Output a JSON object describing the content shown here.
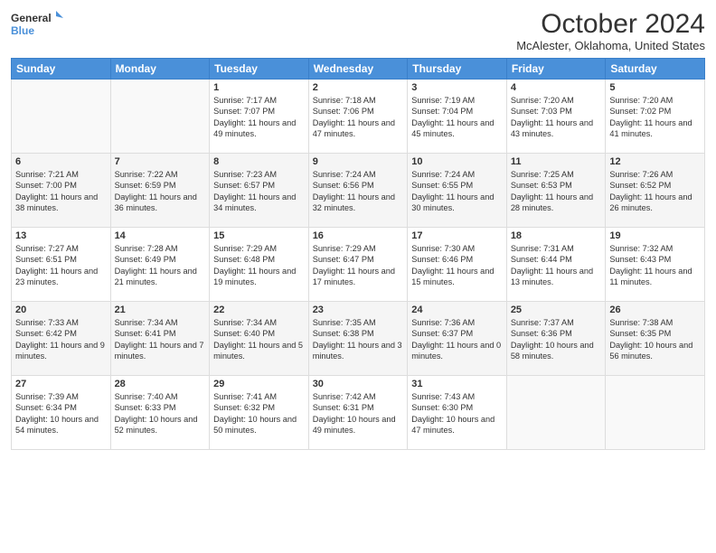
{
  "header": {
    "logo_line1": "General",
    "logo_line2": "Blue",
    "month": "October 2024",
    "location": "McAlester, Oklahoma, United States"
  },
  "days_of_week": [
    "Sunday",
    "Monday",
    "Tuesday",
    "Wednesday",
    "Thursday",
    "Friday",
    "Saturday"
  ],
  "weeks": [
    [
      {
        "day": "",
        "text": ""
      },
      {
        "day": "",
        "text": ""
      },
      {
        "day": "1",
        "text": "Sunrise: 7:17 AM\nSunset: 7:07 PM\nDaylight: 11 hours and 49 minutes."
      },
      {
        "day": "2",
        "text": "Sunrise: 7:18 AM\nSunset: 7:06 PM\nDaylight: 11 hours and 47 minutes."
      },
      {
        "day": "3",
        "text": "Sunrise: 7:19 AM\nSunset: 7:04 PM\nDaylight: 11 hours and 45 minutes."
      },
      {
        "day": "4",
        "text": "Sunrise: 7:20 AM\nSunset: 7:03 PM\nDaylight: 11 hours and 43 minutes."
      },
      {
        "day": "5",
        "text": "Sunrise: 7:20 AM\nSunset: 7:02 PM\nDaylight: 11 hours and 41 minutes."
      }
    ],
    [
      {
        "day": "6",
        "text": "Sunrise: 7:21 AM\nSunset: 7:00 PM\nDaylight: 11 hours and 38 minutes."
      },
      {
        "day": "7",
        "text": "Sunrise: 7:22 AM\nSunset: 6:59 PM\nDaylight: 11 hours and 36 minutes."
      },
      {
        "day": "8",
        "text": "Sunrise: 7:23 AM\nSunset: 6:57 PM\nDaylight: 11 hours and 34 minutes."
      },
      {
        "day": "9",
        "text": "Sunrise: 7:24 AM\nSunset: 6:56 PM\nDaylight: 11 hours and 32 minutes."
      },
      {
        "day": "10",
        "text": "Sunrise: 7:24 AM\nSunset: 6:55 PM\nDaylight: 11 hours and 30 minutes."
      },
      {
        "day": "11",
        "text": "Sunrise: 7:25 AM\nSunset: 6:53 PM\nDaylight: 11 hours and 28 minutes."
      },
      {
        "day": "12",
        "text": "Sunrise: 7:26 AM\nSunset: 6:52 PM\nDaylight: 11 hours and 26 minutes."
      }
    ],
    [
      {
        "day": "13",
        "text": "Sunrise: 7:27 AM\nSunset: 6:51 PM\nDaylight: 11 hours and 23 minutes."
      },
      {
        "day": "14",
        "text": "Sunrise: 7:28 AM\nSunset: 6:49 PM\nDaylight: 11 hours and 21 minutes."
      },
      {
        "day": "15",
        "text": "Sunrise: 7:29 AM\nSunset: 6:48 PM\nDaylight: 11 hours and 19 minutes."
      },
      {
        "day": "16",
        "text": "Sunrise: 7:29 AM\nSunset: 6:47 PM\nDaylight: 11 hours and 17 minutes."
      },
      {
        "day": "17",
        "text": "Sunrise: 7:30 AM\nSunset: 6:46 PM\nDaylight: 11 hours and 15 minutes."
      },
      {
        "day": "18",
        "text": "Sunrise: 7:31 AM\nSunset: 6:44 PM\nDaylight: 11 hours and 13 minutes."
      },
      {
        "day": "19",
        "text": "Sunrise: 7:32 AM\nSunset: 6:43 PM\nDaylight: 11 hours and 11 minutes."
      }
    ],
    [
      {
        "day": "20",
        "text": "Sunrise: 7:33 AM\nSunset: 6:42 PM\nDaylight: 11 hours and 9 minutes."
      },
      {
        "day": "21",
        "text": "Sunrise: 7:34 AM\nSunset: 6:41 PM\nDaylight: 11 hours and 7 minutes."
      },
      {
        "day": "22",
        "text": "Sunrise: 7:34 AM\nSunset: 6:40 PM\nDaylight: 11 hours and 5 minutes."
      },
      {
        "day": "23",
        "text": "Sunrise: 7:35 AM\nSunset: 6:38 PM\nDaylight: 11 hours and 3 minutes."
      },
      {
        "day": "24",
        "text": "Sunrise: 7:36 AM\nSunset: 6:37 PM\nDaylight: 11 hours and 0 minutes."
      },
      {
        "day": "25",
        "text": "Sunrise: 7:37 AM\nSunset: 6:36 PM\nDaylight: 10 hours and 58 minutes."
      },
      {
        "day": "26",
        "text": "Sunrise: 7:38 AM\nSunset: 6:35 PM\nDaylight: 10 hours and 56 minutes."
      }
    ],
    [
      {
        "day": "27",
        "text": "Sunrise: 7:39 AM\nSunset: 6:34 PM\nDaylight: 10 hours and 54 minutes."
      },
      {
        "day": "28",
        "text": "Sunrise: 7:40 AM\nSunset: 6:33 PM\nDaylight: 10 hours and 52 minutes."
      },
      {
        "day": "29",
        "text": "Sunrise: 7:41 AM\nSunset: 6:32 PM\nDaylight: 10 hours and 50 minutes."
      },
      {
        "day": "30",
        "text": "Sunrise: 7:42 AM\nSunset: 6:31 PM\nDaylight: 10 hours and 49 minutes."
      },
      {
        "day": "31",
        "text": "Sunrise: 7:43 AM\nSunset: 6:30 PM\nDaylight: 10 hours and 47 minutes."
      },
      {
        "day": "",
        "text": ""
      },
      {
        "day": "",
        "text": ""
      }
    ]
  ]
}
